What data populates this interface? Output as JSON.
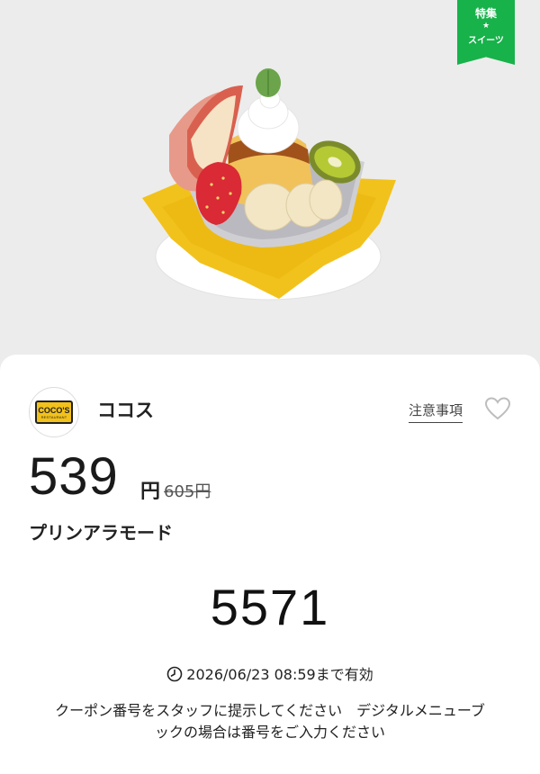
{
  "badge": {
    "top": "特集",
    "star": "★",
    "bottom": "スイーツ"
  },
  "hero": {
    "image": "dessert-pudding-a-la-mode"
  },
  "shop": {
    "logo_line1": "COCO'S",
    "logo_line2": "RESTAURANT",
    "name": "ココス"
  },
  "actions": {
    "notes_label": "注意事項",
    "favorite_icon": "heart-outline-icon"
  },
  "price": {
    "current": "539",
    "unit": "円",
    "original": "605円"
  },
  "item": {
    "name": "プリンアラモード"
  },
  "coupon": {
    "code": "5571"
  },
  "expiry": {
    "text": "2026/06/23 08:59まで有効",
    "icon": "clock-icon"
  },
  "note": {
    "line1": "クーポン番号をスタッフに提示してください　デジタルメニューブ",
    "line2": "ックの場合は番号をご入力ください"
  },
  "colors": {
    "badge_green": "#17b24a",
    "logo_yellow": "#f3c21a"
  }
}
